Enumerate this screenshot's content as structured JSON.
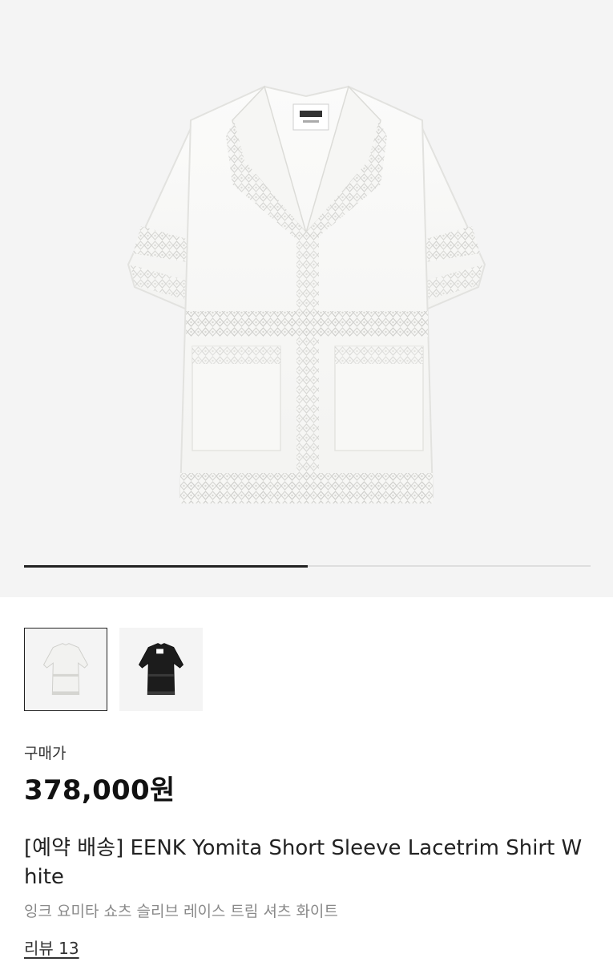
{
  "product": {
    "images": {
      "main_image_icon": "white-lace-short-sleeve-shirt",
      "thumbnails": [
        {
          "icon": "white-shirt-thumbnail-icon",
          "color": "#f2f2f0",
          "selected": true
        },
        {
          "icon": "black-shirt-thumbnail-icon",
          "color": "#1c1c1c",
          "selected": false
        }
      ],
      "gallery_progress": 0.5
    },
    "price_label": "구매가",
    "price": "378,000원",
    "title": "[예약 배송] EENK Yomita Short Sleeve Lacetrim Shirt White",
    "subtitle": "잉크 요미타 쇼츠 슬리브 레이스 트림 셔츠 화이트",
    "review_link": "리뷰 13"
  },
  "colors": {
    "hero_bg": "#f4f4f4",
    "progress_active": "#222222",
    "progress_track": "#dedede",
    "subtitle": "#8a8a8a"
  }
}
